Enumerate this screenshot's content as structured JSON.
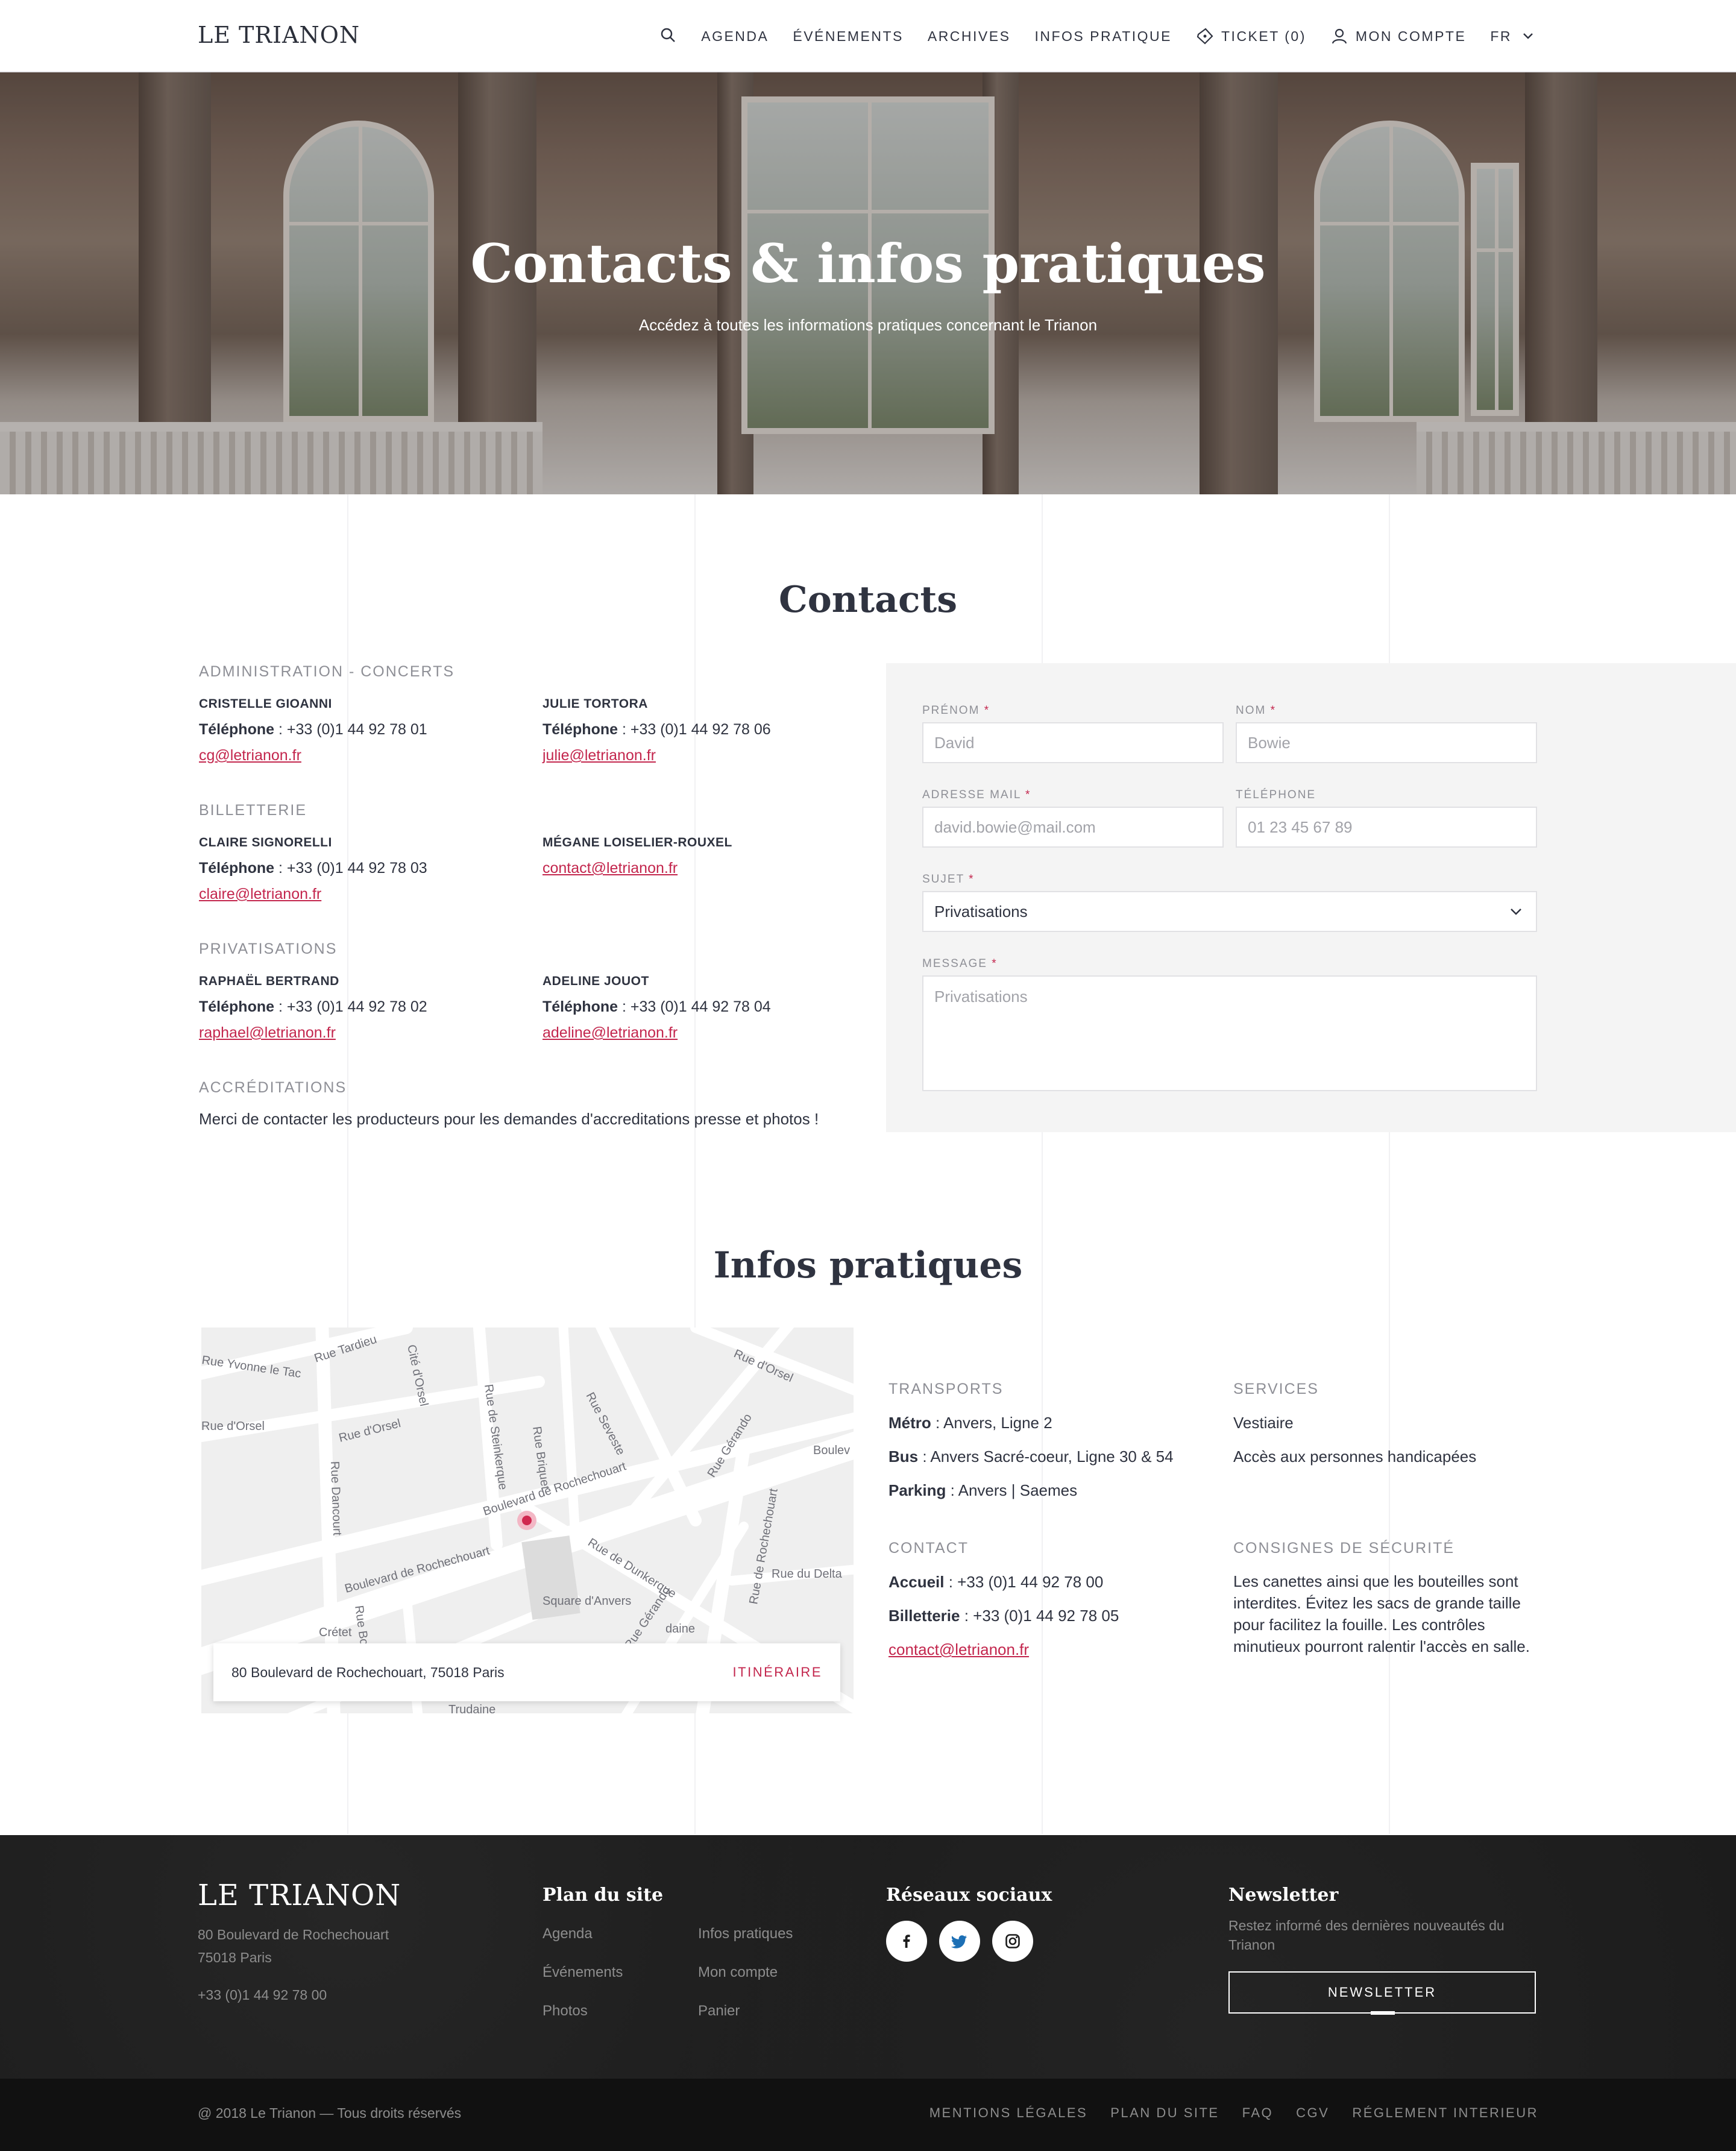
{
  "header": {
    "logo": "LE TRIANON",
    "nav": {
      "agenda": "AGENDA",
      "evenements": "ÉVÉNEMENTS",
      "archives": "ARCHIVES",
      "infos": "INFOS PRATIQUE",
      "ticket": "TICKET (0)",
      "compte": "MON COMPTE",
      "lang": "FR"
    }
  },
  "hero": {
    "title": "Contacts & infos pratiques",
    "subtitle": "Accédez à toutes les informations pratiques concernant le Trianon"
  },
  "contacts": {
    "title": "Contacts",
    "groups": [
      {
        "title": "ADMINISTRATION - CONCERTS",
        "people": [
          {
            "name": "CRISTELLE GIOANNI",
            "tel_label": "Téléphone",
            "tel": " : +33 (0)1 44 92 78 01",
            "email": "cg@letrianon.fr"
          },
          {
            "name": "JULIE TORTORA",
            "tel_label": "Téléphone",
            "tel": " : +33 (0)1 44 92 78 06",
            "email": "julie@letrianon.fr"
          }
        ]
      },
      {
        "title": "BILLETTERIE",
        "people": [
          {
            "name": "CLAIRE SIGNORELLI",
            "tel_label": "Téléphone",
            "tel": " : +33 (0)1 44 92 78 03",
            "email": "claire@letrianon.fr"
          },
          {
            "name": "MÉGANE LOISELIER-ROUXEL",
            "email": "contact@letrianon.fr"
          }
        ]
      },
      {
        "title": "PRIVATISATIONS",
        "people": [
          {
            "name": "RAPHAËL BERTRAND",
            "tel_label": "Téléphone",
            "tel": " : +33 (0)1 44 92 78 02",
            "email": "raphael@letrianon.fr"
          },
          {
            "name": "ADELINE JOUOT",
            "tel_label": "Téléphone",
            "tel": " : +33 (0)1 44 92 78 04",
            "email": "adeline@letrianon.fr"
          }
        ]
      }
    ],
    "accreditations": {
      "title": "ACCRÉDITATIONS",
      "text": "Merci de contacter les producteurs pour les demandes d'accreditations presse et photos !"
    }
  },
  "form": {
    "prenom": {
      "label": "PRÉNOM",
      "placeholder": "David"
    },
    "nom": {
      "label": "NOM",
      "placeholder": "Bowie"
    },
    "email": {
      "label": "ADRESSE MAIL",
      "placeholder": "david.bowie@mail.com"
    },
    "telephone": {
      "label": "TÉLÉPHONE",
      "placeholder": "01 23 45 67 89"
    },
    "sujet": {
      "label": "SUJET",
      "value": "Privatisations"
    },
    "message": {
      "label": "MESSAGE",
      "placeholder": "Privatisations"
    },
    "required_mark": "*"
  },
  "infos": {
    "title": "Infos pratiques",
    "map": {
      "address": "80 Boulevard de Rochechouart, 75018 Paris",
      "itinerary": "ITINÉRAIRE",
      "streets": {
        "s1": "Rue Yvonne le Tac",
        "s2": "Rue Tardieu",
        "s3": "Cité d'Orsel",
        "s4": "Rue d'Orsel",
        "s5": "Rue d'Orsel",
        "s6": "Rue de Steinkerque",
        "s7": "Rue Briquet",
        "s8": "Rue Seveste",
        "s9": "Rue Dancourt",
        "s10": "Boulevard de Rochechouart",
        "s11": "Boulevard de Rochechouart",
        "s12": "Rue de Dunkerque",
        "s13": "Rue Gérando",
        "s14": "Rue de Rochechouart",
        "s15": "Rue du Delta",
        "s16": "Square d'Anvers",
        "s17": "Rue Gérando",
        "s18": "Rue d'Orsel",
        "s19": "Boulev",
        "s20": "Crétet",
        "s21": "Rue Bo",
        "s22": "Trudaine",
        "s23": "daine"
      }
    },
    "transports": {
      "title": "TRANSPORTS",
      "metro_label": "Métro",
      "metro": " :  Anvers, Ligne 2",
      "bus_label": "Bus",
      "bus": " : Anvers Sacré-coeur, Ligne 30 & 54",
      "parking_label": "Parking",
      "parking": " : Anvers | Saemes"
    },
    "services": {
      "title": "SERVICES",
      "items": [
        "Vestiaire",
        "Accès aux personnes handicapées"
      ]
    },
    "contact": {
      "title": "CONTACT",
      "accueil_label": "Accueil",
      "accueil": " :  +33 (0)1 44 92 78 00",
      "billetterie_label": "Billetterie",
      "billetterie": " :  +33 (0)1 44 92 78 05",
      "email": "contact@letrianon.fr"
    },
    "securite": {
      "title": "CONSIGNES DE SÉCURITÉ",
      "text": "Les canettes ainsi que les bouteilles sont interdites. Évitez les sacs de grande taille pour facilitez la fouille. Les contrôles minutieux pourront ralentir l'accès en salle."
    }
  },
  "footer": {
    "logo": "LE TRIANON",
    "address1": "80 Boulevard de Rochechouart",
    "address2": "75018 Paris",
    "phone": "+33 (0)1 44 92 78 00",
    "plan_title": "Plan du site",
    "plan_links": [
      "Agenda",
      "Infos pratiques",
      "Événements",
      "Mon compte",
      "Photos",
      "Panier"
    ],
    "social_title": "Réseaux sociaux",
    "social_icons": [
      "facebook-icon",
      "twitter-icon",
      "instagram-icon"
    ],
    "newsletter_title": "Newsletter",
    "newsletter_text": "Restez informé des dernières nouveautés du Trianon",
    "newsletter_button": "NEWSLETTER",
    "copyright": "@ 2018 Le Trianon — Tous droits réservés",
    "bottom_links": [
      "MENTIONS LÉGALES",
      "PLAN DU SITE",
      "FAQ",
      "CGV",
      "RÉGLEMENT INTERIEUR"
    ]
  },
  "colors": {
    "accent": "#c3264d",
    "text": "#2f3340",
    "muted": "#8e8f96",
    "footer_bg": "#1c1c1c"
  }
}
